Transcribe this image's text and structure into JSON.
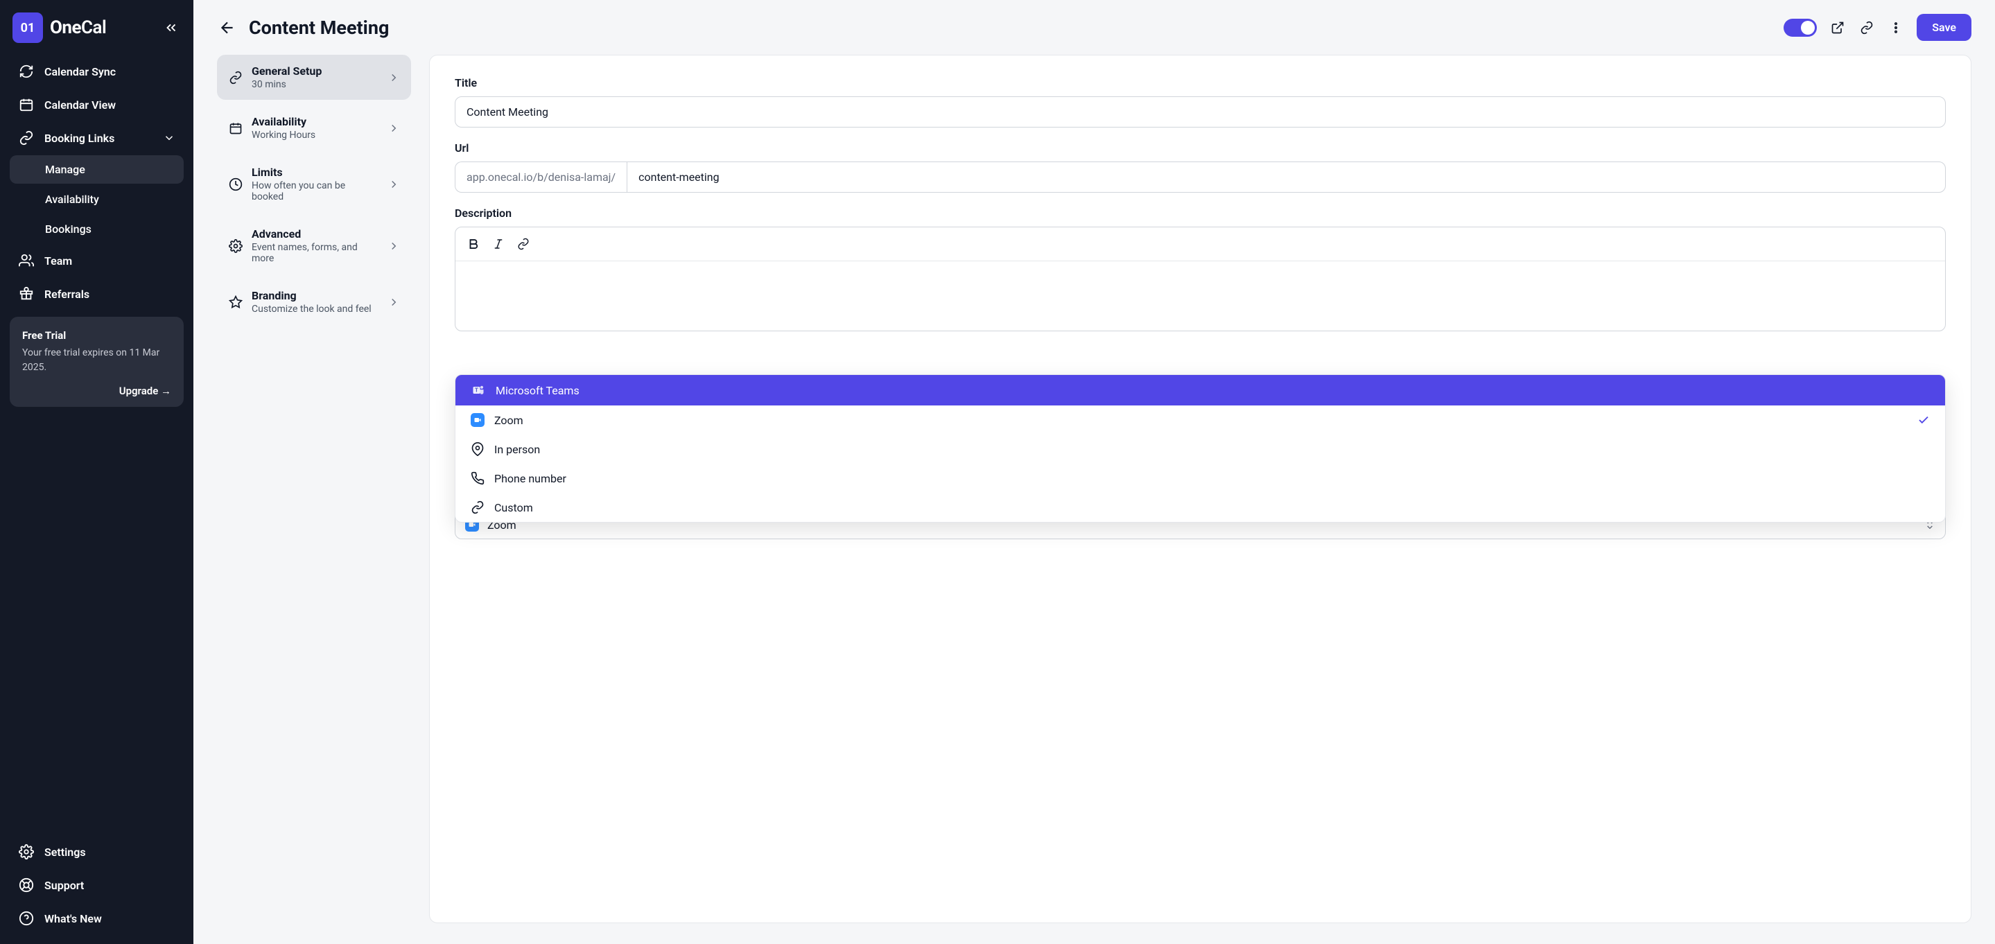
{
  "brand": {
    "badge_text": "01",
    "name_bold": "One",
    "name_light": "Cal"
  },
  "sidebar": {
    "items": [
      {
        "label": "Calendar Sync",
        "icon": "sync-icon"
      },
      {
        "label": "Calendar View",
        "icon": "calendar-icon"
      },
      {
        "label": "Booking Links",
        "icon": "link-icon",
        "expanded": true
      },
      {
        "label": "Manage",
        "sub": true,
        "active": true
      },
      {
        "label": "Availability",
        "sub": true
      },
      {
        "label": "Bookings",
        "sub": true
      },
      {
        "label": "Team",
        "icon": "team-icon"
      },
      {
        "label": "Referrals",
        "icon": "gift-icon"
      }
    ],
    "trial": {
      "title": "Free Trial",
      "desc": "Your free trial expires on 11 Mar 2025.",
      "cta": "Upgrade →"
    },
    "bottom": [
      {
        "label": "Settings",
        "icon": "gear-icon"
      },
      {
        "label": "Support",
        "icon": "support-icon"
      },
      {
        "label": "What's New",
        "icon": "help-icon"
      }
    ]
  },
  "header": {
    "page_title": "Content Meeting",
    "save_label": "Save"
  },
  "sections": [
    {
      "title": "General Setup",
      "sub": "30 mins",
      "icon": "link",
      "active": true
    },
    {
      "title": "Availability",
      "sub": "Working Hours",
      "icon": "calendar"
    },
    {
      "title": "Limits",
      "sub": "How often you can be booked",
      "icon": "clock"
    },
    {
      "title": "Advanced",
      "sub": "Event names, forms, and more",
      "icon": "gear"
    },
    {
      "title": "Branding",
      "sub": "Customize the look and feel",
      "icon": "star"
    }
  ],
  "form": {
    "title_label": "Title",
    "title_value": "Content Meeting",
    "url_label": "Url",
    "url_prefix": "app.onecal.io/b/denisa-lamaj/",
    "url_slug": "content-meeting",
    "description_label": "Description"
  },
  "location_options": [
    {
      "label": "Microsoft Teams",
      "icon": "teams",
      "highlighted": true
    },
    {
      "label": "Zoom",
      "icon": "zoom",
      "selected": true
    },
    {
      "label": "In person",
      "icon": "pin"
    },
    {
      "label": "Phone number",
      "icon": "phone"
    },
    {
      "label": "Custom",
      "icon": "link"
    }
  ],
  "location_selected_label": "Zoom"
}
